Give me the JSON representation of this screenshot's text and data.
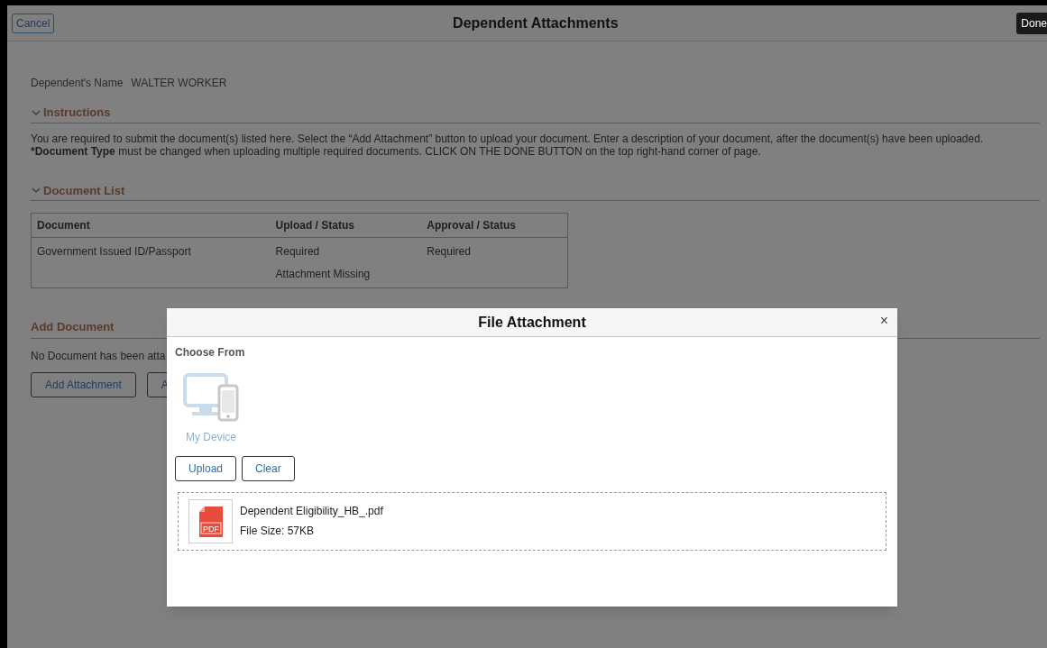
{
  "header": {
    "title": "Dependent Attachments",
    "cancel_button": "Cancel",
    "done_button": "Done"
  },
  "dependent": {
    "label": "Dependent's Name",
    "value": "WALTER WORKER"
  },
  "instructions": {
    "heading": "Instructions",
    "expanded": true,
    "lines": [
      "You are required to submit the document(s) listed here. Select the “Add Attachment” button to upload your document. Enter a description of your document, after the document(s) have been uploaded.",
      "***Document Type** must be changed when uploading multiple required documents. CLICK ON THE DONE BUTTON on the top right-hand corner of page."
    ]
  },
  "document_list": {
    "heading": "Document List",
    "expanded": true,
    "columns": [
      "Document",
      "Upload / Status",
      "Approval / Status"
    ],
    "rows": [
      {
        "cells": [
          [
            "Government Issued ID/Passport"
          ],
          [
            "Required",
            "Attachment Missing"
          ],
          [
            "Required"
          ]
        ]
      }
    ]
  },
  "add_document": {
    "heading": "Add Document",
    "message": "No Document has been atta",
    "buttons": [
      "Add Attachment",
      "A"
    ]
  },
  "dialog": {
    "title": "File Attachment",
    "close": "×",
    "section": "Choose From",
    "source": "My Device",
    "buttons": [
      "Upload",
      "Clear"
    ],
    "files": [
      {
        "name": "Dependent Eligibility_HB_.pdf",
        "size": "File Size: 57KB",
        "icon_label": "PDF"
      }
    ]
  }
}
